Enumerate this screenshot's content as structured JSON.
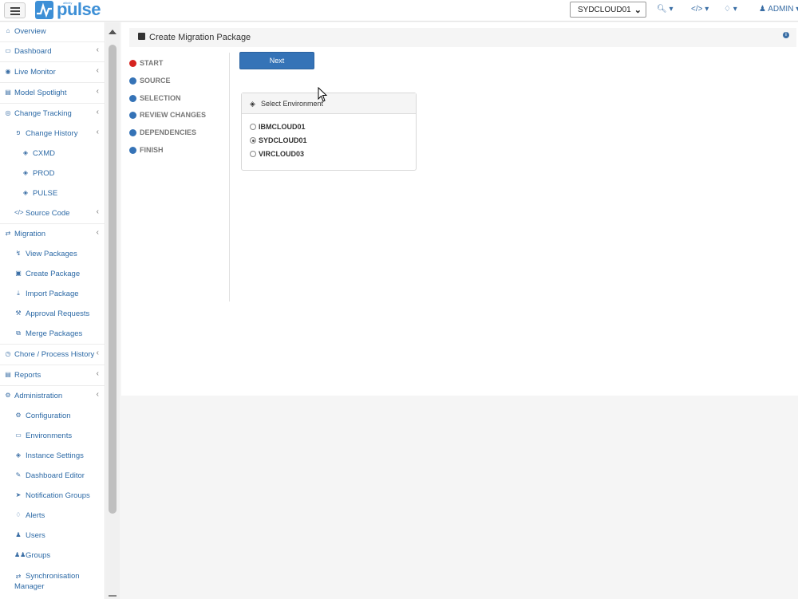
{
  "topbar": {
    "logo_small": "altinity",
    "logo_text": "pulse",
    "instance_select": "SYDCLOUD01",
    "admin_label": "ADMIN"
  },
  "sidebar": {
    "items": [
      {
        "label": "Overview",
        "icon": "home-icon",
        "level": 0
      },
      {
        "label": "Dashboard",
        "icon": "desktop-icon",
        "level": 0,
        "expandable": true
      },
      {
        "label": "Live Monitor",
        "icon": "binoculars-icon",
        "level": 0,
        "expandable": true
      },
      {
        "label": "Model Spotlight",
        "icon": "spotlight-icon",
        "level": 0,
        "expandable": true
      },
      {
        "label": "Change Tracking",
        "icon": "eye-icon",
        "level": 0,
        "expandable": true
      },
      {
        "label": "Change History",
        "icon": "branch-icon",
        "level": 1,
        "expandable": true
      },
      {
        "label": "CXMD",
        "icon": "cubes-icon",
        "level": 2
      },
      {
        "label": "PROD",
        "icon": "cubes-icon",
        "level": 2
      },
      {
        "label": "PULSE",
        "icon": "cubes-icon",
        "level": 2
      },
      {
        "label": "Source Code",
        "icon": "code-icon",
        "level": 1,
        "expandable": true
      },
      {
        "label": "Migration",
        "icon": "exchange-icon",
        "level": 0,
        "expandable": true
      },
      {
        "label": "View Packages",
        "icon": "bolt-icon",
        "level": 1
      },
      {
        "label": "Create Package",
        "icon": "archive-icon",
        "level": 1
      },
      {
        "label": "Import Package",
        "icon": "download-icon",
        "level": 1
      },
      {
        "label": "Approval Requests",
        "icon": "gavel-icon",
        "level": 1
      },
      {
        "label": "Merge Packages",
        "icon": "copy-icon",
        "level": 1
      },
      {
        "label": "Chore / Process History",
        "icon": "clock-icon",
        "level": 0,
        "expandable": true
      },
      {
        "label": "Reports",
        "icon": "list-icon",
        "level": 0,
        "expandable": true
      },
      {
        "label": "Administration",
        "icon": "cogs-icon",
        "level": 0,
        "expandable": true
      },
      {
        "label": "Configuration",
        "icon": "cog-icon",
        "level": 1
      },
      {
        "label": "Environments",
        "icon": "monitor-icon",
        "level": 1
      },
      {
        "label": "Instance Settings",
        "icon": "cubes-icon",
        "level": 1
      },
      {
        "label": "Dashboard Editor",
        "icon": "edit-icon",
        "level": 1
      },
      {
        "label": "Notification Groups",
        "icon": "paper-plane-icon",
        "level": 1
      },
      {
        "label": "Alerts",
        "icon": "bell-icon",
        "level": 1
      },
      {
        "label": "Users",
        "icon": "user-icon",
        "level": 1
      },
      {
        "label": "Groups",
        "icon": "users-icon",
        "level": 1
      },
      {
        "label": "Synchronisation Manager",
        "icon": "sync-icon",
        "level": 1
      }
    ]
  },
  "main": {
    "title": "Create Migration Package",
    "steps": [
      {
        "label": "START",
        "active": true
      },
      {
        "label": "SOURCE"
      },
      {
        "label": "SELECTION"
      },
      {
        "label": "REVIEW CHANGES"
      },
      {
        "label": "DEPENDENCIES"
      },
      {
        "label": "FINISH"
      }
    ],
    "next_label": "Next",
    "env_panel": {
      "title": "Select Environment",
      "options": [
        {
          "label": "IBMCLOUD01",
          "checked": false
        },
        {
          "label": "SYDCLOUD01",
          "checked": true
        },
        {
          "label": "VIRCLOUD03",
          "checked": false
        }
      ]
    }
  },
  "colors": {
    "accent": "#3573b7",
    "active_step": "#d6231f",
    "link": "#2d6aa6"
  }
}
